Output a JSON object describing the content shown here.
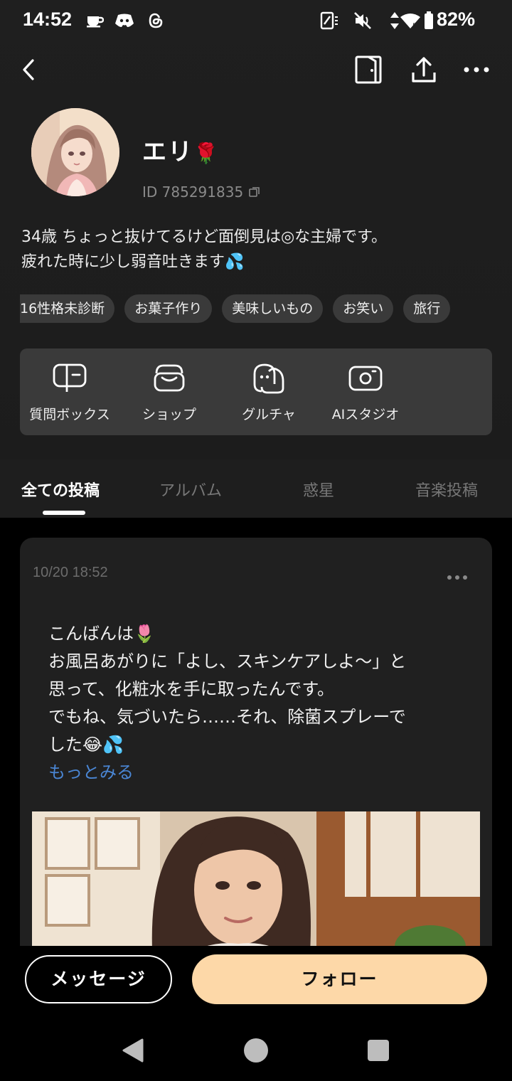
{
  "status_bar": {
    "time": "14:52",
    "battery": "82%",
    "icons": [
      "tea-cup-icon",
      "discord-icon",
      "threads-icon",
      "nfc-icon",
      "mute-icon",
      "data-arrows-icon",
      "wifi-icon",
      "battery-icon"
    ]
  },
  "nav": {
    "icons": [
      "back-chevron-icon",
      "door-exit-icon",
      "share-upload-icon",
      "more-horizontal-icon"
    ]
  },
  "profile": {
    "name": "エリ",
    "name_emoji": "🌹",
    "id_text": "ID 785291835",
    "bio_lines": [
      "34歳 ちょっと抜けてるけど面倒見は◎な主婦です。",
      "疲れた時に少し弱音吐きます💦"
    ],
    "tags": [
      "16性格未診断",
      "お菓子作り",
      "美味しいもの",
      "お笑い",
      "旅行"
    ]
  },
  "features": [
    {
      "label": "質問ボックス",
      "icon": "question-box-icon"
    },
    {
      "label": "ショップ",
      "icon": "shop-icon"
    },
    {
      "label": "グルチャ",
      "icon": "group-chat-icon"
    },
    {
      "label": "AIスタジオ",
      "icon": "ai-studio-icon"
    }
  ],
  "tabs": [
    {
      "label": "全ての投稿",
      "active": true
    },
    {
      "label": "アルバム",
      "active": false
    },
    {
      "label": "惑星",
      "active": false
    },
    {
      "label": "音楽投稿",
      "active": false
    }
  ],
  "post": {
    "timestamp": "10/20 18:52",
    "lines": [
      "こんばんは🌷",
      "お風呂あがりに「よし、スキンケアしよ〜」と",
      "思って、化粧水を手に取ったんです。",
      "でもね、気づいたら……それ、除菌スプレーで",
      "した😂💦"
    ],
    "read_more": "もっとみる"
  },
  "actions": {
    "message": "メッセージ",
    "follow": "フォロー"
  },
  "colors": {
    "background": "#000000",
    "header_bg": "#1f1f1f",
    "chip_bg": "#3a3a3a",
    "follow_button": "#fdd8a8",
    "link": "#4a86d4",
    "muted_text": "#8a8a8a"
  }
}
